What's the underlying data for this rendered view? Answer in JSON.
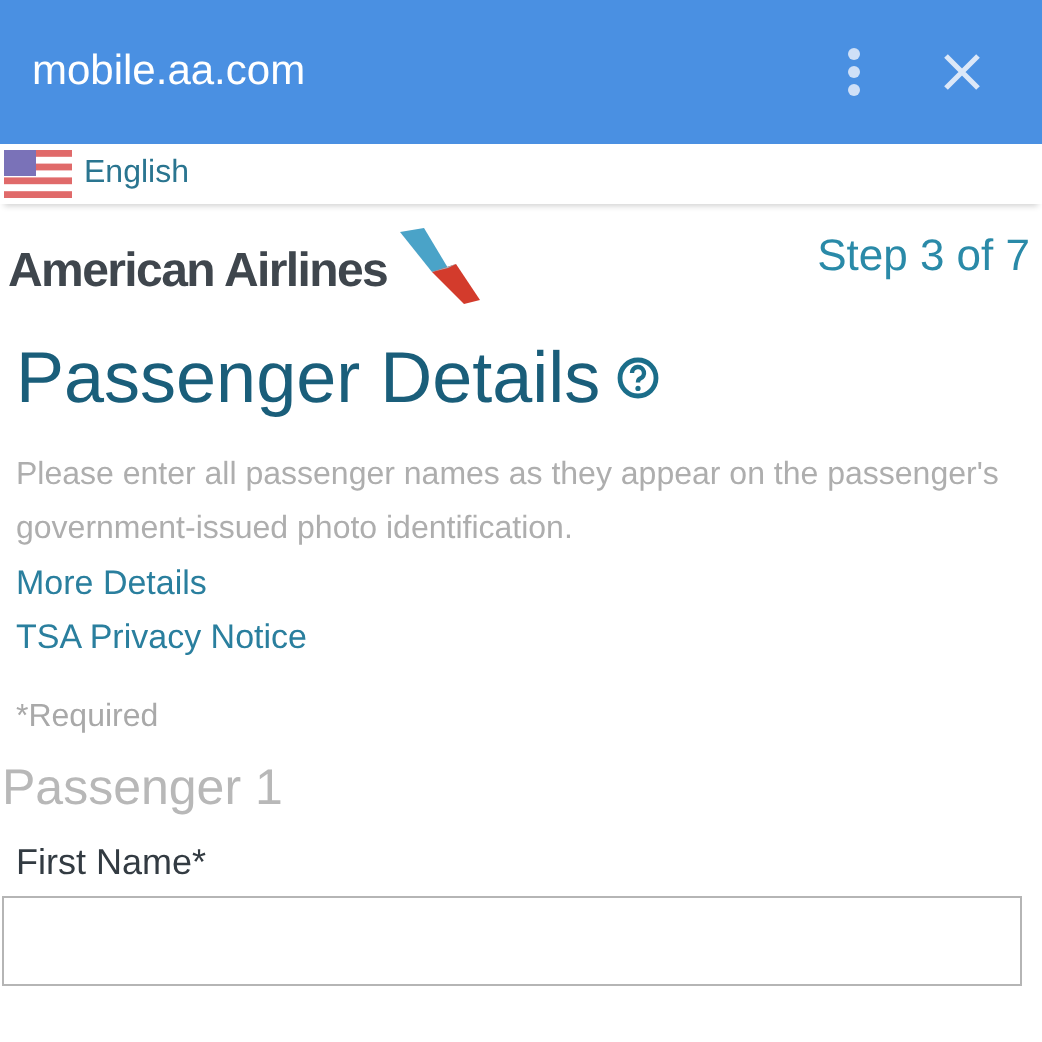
{
  "browser_bar": {
    "url": "mobile.aa.com"
  },
  "language": {
    "label": "English"
  },
  "header": {
    "brand": "American Airlines",
    "step": "Step 3 of 7"
  },
  "page": {
    "title": "Passenger Details",
    "description": "Please enter all passenger names as they appear on the passenger's government-issued photo identification.",
    "links": [
      "More Details",
      "TSA Privacy Notice"
    ],
    "required_note": "*Required",
    "passenger_heading": "Passenger 1",
    "fields": [
      {
        "label": "First Name*"
      }
    ]
  }
}
